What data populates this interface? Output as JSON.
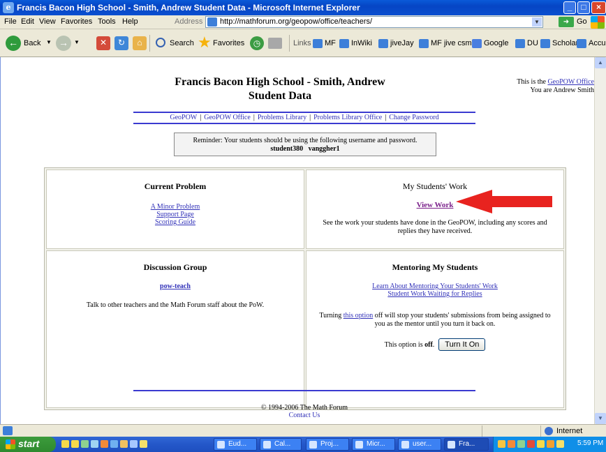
{
  "window": {
    "title": "Francis Bacon High School - Smith, Andrew Student Data - Microsoft Internet Explorer"
  },
  "menubar": {
    "items": [
      "File",
      "Edit",
      "View",
      "Favorites",
      "Tools",
      "Help"
    ],
    "address_label": "Address",
    "url": "http://mathforum.org/geopow/office/teachers/",
    "go_label": "Go"
  },
  "toolbar": {
    "back_label": "Back",
    "search_label": "Search",
    "favorites_label": "Favorites",
    "links_label": "Links",
    "links": [
      "MF",
      "InWiki",
      "jiveJay",
      "MF jive csm",
      "Google",
      "DU",
      "Scholar",
      "Accu"
    ]
  },
  "page": {
    "title_line1": "Francis Bacon High School - Smith, Andrew",
    "title_line2": "Student Data",
    "office_note_prefix": "This is the ",
    "office_note_link": "GeoPOW Office",
    "office_note_line2": "You are Andrew Smith",
    "nav": [
      "GeoPOW",
      "GeoPOW Office",
      "Problems Library",
      "Problems Library Office",
      "Change Password"
    ],
    "reminder_text": "Reminder: Your students should be using the following username and password.",
    "reminder_username": "student380",
    "reminder_password": "vanggher1",
    "current_problem": {
      "heading": "Current Problem",
      "links": [
        "A Minor Problem",
        "Support Page",
        "Scoring Guide"
      ]
    },
    "students_work": {
      "heading": "My Students' Work",
      "link": "View Work",
      "description": "See the work your students have done in the GeoPOW, including any scores and replies they have received."
    },
    "discussion": {
      "heading": "Discussion Group",
      "link": "pow-teach",
      "description": "Talk to other teachers and the Math Forum staff about the PoW."
    },
    "mentoring": {
      "heading": "Mentoring My Students",
      "links": [
        "Learn About Mentoring Your Students' Work",
        "Student Work Waiting for Replies"
      ],
      "text_before": "Turning ",
      "option_link": "this option",
      "text_after": " off will stop your students' submissions from being assigned to you as the mentor until you turn it back on.",
      "status_prefix": "This option is ",
      "status_value": "off",
      "button_label": "Turn It On"
    },
    "footer_copyright": "© 1994-2006 The Math Forum",
    "footer_link": "Contact Us"
  },
  "statusbar": {
    "zone": "Internet"
  },
  "taskbar": {
    "start_label": "start",
    "tasks": [
      "Eud...",
      "Cal...",
      "Proj...",
      "Micr...",
      "user...",
      "Fra..."
    ],
    "clock": "5:59 PM"
  },
  "colors": {
    "link": "#3030b8",
    "arrow": "#e8231f",
    "nav_line": "#3a3ad0"
  }
}
